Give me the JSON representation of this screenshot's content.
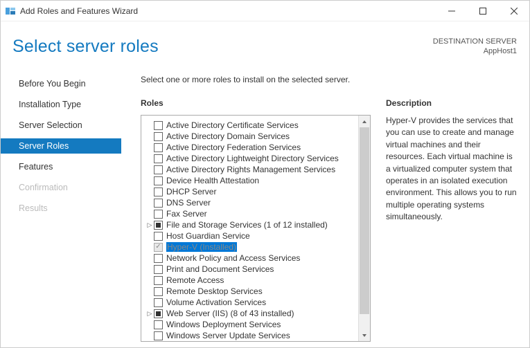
{
  "window": {
    "title": "Add Roles and Features Wizard"
  },
  "header": {
    "page_title": "Select server roles",
    "destination_label": "DESTINATION SERVER",
    "destination_value": "AppHost1"
  },
  "nav": {
    "items": [
      {
        "label": "Before You Begin",
        "state": "normal"
      },
      {
        "label": "Installation Type",
        "state": "normal"
      },
      {
        "label": "Server Selection",
        "state": "normal"
      },
      {
        "label": "Server Roles",
        "state": "selected"
      },
      {
        "label": "Features",
        "state": "normal"
      },
      {
        "label": "Confirmation",
        "state": "disabled"
      },
      {
        "label": "Results",
        "state": "disabled"
      }
    ]
  },
  "main": {
    "instruction": "Select one or more roles to install on the selected server.",
    "roles_label": "Roles",
    "description_label": "Description",
    "description_text": "Hyper-V provides the services that you can use to create and manage virtual machines and their resources. Each virtual machine is a virtualized computer system that operates in an isolated execution environment. This allows you to run multiple operating systems simultaneously.",
    "roles": [
      {
        "label": "Active Directory Certificate Services",
        "check": "empty",
        "expander": ""
      },
      {
        "label": "Active Directory Domain Services",
        "check": "empty",
        "expander": ""
      },
      {
        "label": "Active Directory Federation Services",
        "check": "empty",
        "expander": ""
      },
      {
        "label": "Active Directory Lightweight Directory Services",
        "check": "empty",
        "expander": ""
      },
      {
        "label": "Active Directory Rights Management Services",
        "check": "empty",
        "expander": ""
      },
      {
        "label": "Device Health Attestation",
        "check": "empty",
        "expander": ""
      },
      {
        "label": "DHCP Server",
        "check": "empty",
        "expander": ""
      },
      {
        "label": "DNS Server",
        "check": "empty",
        "expander": ""
      },
      {
        "label": "Fax Server",
        "check": "empty",
        "expander": ""
      },
      {
        "label": "File and Storage Services (1 of 12 installed)",
        "check": "partial",
        "expander": "▷"
      },
      {
        "label": "Host Guardian Service",
        "check": "empty",
        "expander": ""
      },
      {
        "label": "Hyper-V (Installed)",
        "check": "checked-disabled",
        "expander": "",
        "selected": true,
        "disabled": true
      },
      {
        "label": "Network Policy and Access Services",
        "check": "empty",
        "expander": ""
      },
      {
        "label": "Print and Document Services",
        "check": "empty",
        "expander": ""
      },
      {
        "label": "Remote Access",
        "check": "empty",
        "expander": ""
      },
      {
        "label": "Remote Desktop Services",
        "check": "empty",
        "expander": ""
      },
      {
        "label": "Volume Activation Services",
        "check": "empty",
        "expander": ""
      },
      {
        "label": "Web Server (IIS) (8 of 43 installed)",
        "check": "partial",
        "expander": "▷"
      },
      {
        "label": "Windows Deployment Services",
        "check": "empty",
        "expander": ""
      },
      {
        "label": "Windows Server Update Services",
        "check": "empty",
        "expander": ""
      }
    ]
  }
}
